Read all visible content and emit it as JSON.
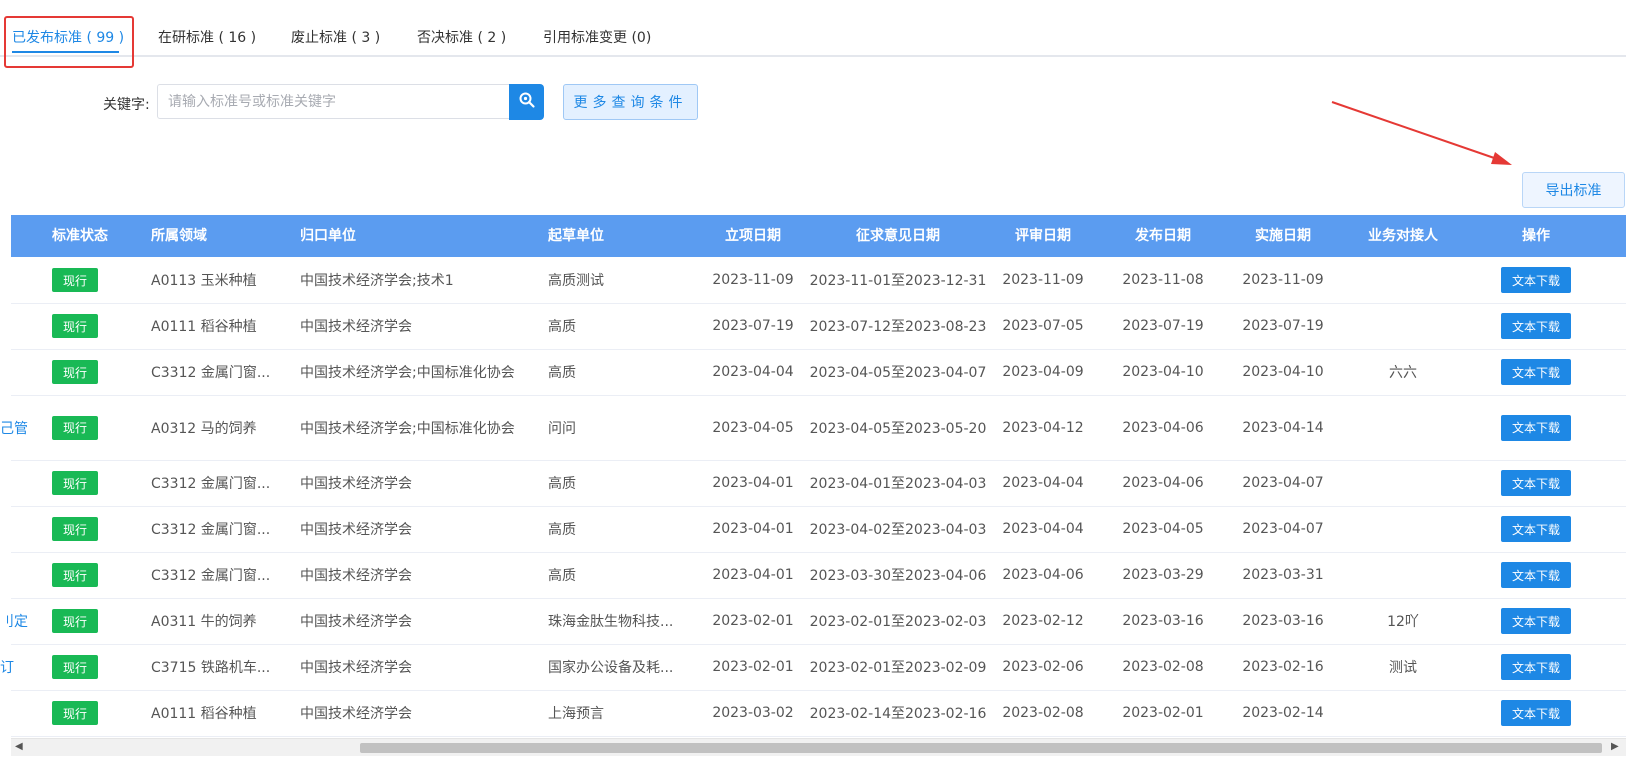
{
  "tabs": [
    {
      "label": "已发布标准 ( 99 )",
      "active": true
    },
    {
      "label": "在研标准 ( 16 )"
    },
    {
      "label": "废止标准 ( 3 )"
    },
    {
      "label": "否决标准 ( 2 )"
    },
    {
      "label": "引用标准变更 (0)"
    }
  ],
  "search": {
    "label": "关键字:",
    "placeholder": "请输入标准号或标准关键字",
    "search_icon": "search-icon",
    "more_label": "更多查询条件"
  },
  "export_label": "导出标准",
  "colors": {
    "accent": "#1e88e5",
    "header_bg": "#5b9cf0",
    "badge": "#19b955",
    "annotation": "#e53935"
  },
  "table": {
    "columns": [
      "标准状态",
      "所属领域",
      "归口单位",
      "起草单位",
      "立项日期",
      "征求意见日期",
      "评审日期",
      "发布日期",
      "实施日期",
      "业务对接人",
      "操作"
    ],
    "rows": [
      {
        "edge": "",
        "status": "现行",
        "domain": "A0113 玉米种植",
        "org": "中国技术经济学会;技术1",
        "drafter": "高质测试",
        "init": "2023-11-09",
        "comment": "2023-11-01至2023-12-31",
        "review": "2023-11-09",
        "publish": "2023-11-08",
        "impl": "2023-11-09",
        "contact": "",
        "action": "文本下载"
      },
      {
        "edge": "",
        "status": "现行",
        "domain": "A0111 稻谷种植",
        "org": "中国技术经济学会",
        "drafter": "高质",
        "init": "2023-07-19",
        "comment": "2023-07-12至2023-08-23",
        "review": "2023-07-05",
        "publish": "2023-07-19",
        "impl": "2023-07-19",
        "contact": "",
        "action": "文本下载"
      },
      {
        "edge": "",
        "status": "现行",
        "domain": "C3312 金属门窗...",
        "org": "中国技术经济学会;中国标准化协会",
        "drafter": "高质",
        "init": "2023-04-04",
        "comment": "2023-04-05至2023-04-07",
        "review": "2023-04-09",
        "publish": "2023-04-10",
        "impl": "2023-04-10",
        "contact": "六六",
        "action": "文本下载"
      },
      {
        "edge": "己管",
        "status": "现行",
        "domain": "A0312 马的饲养",
        "org": "中国技术经济学会;中国标准化协会",
        "drafter": "问问",
        "init": "2023-04-05",
        "comment": "2023-04-05至2023-05-20",
        "review": "2023-04-12",
        "publish": "2023-04-06",
        "impl": "2023-04-14",
        "contact": "",
        "action": "文本下载"
      },
      {
        "edge": "",
        "status": "现行",
        "domain": "C3312 金属门窗...",
        "org": "中国技术经济学会",
        "drafter": "高质",
        "init": "2023-04-01",
        "comment": "2023-04-01至2023-04-03",
        "review": "2023-04-04",
        "publish": "2023-04-06",
        "impl": "2023-04-07",
        "contact": "",
        "action": "文本下载"
      },
      {
        "edge": "",
        "status": "现行",
        "domain": "C3312 金属门窗...",
        "org": "中国技术经济学会",
        "drafter": "高质",
        "init": "2023-04-01",
        "comment": "2023-04-02至2023-04-03",
        "review": "2023-04-04",
        "publish": "2023-04-05",
        "impl": "2023-04-07",
        "contact": "",
        "action": "文本下载"
      },
      {
        "edge": "",
        "status": "现行",
        "domain": "C3312 金属门窗...",
        "org": "中国技术经济学会",
        "drafter": "高质",
        "init": "2023-04-01",
        "comment": "2023-03-30至2023-04-06",
        "review": "2023-04-06",
        "publish": "2023-03-29",
        "impl": "2023-03-31",
        "contact": "",
        "action": "文本下载"
      },
      {
        "edge": "刂定",
        "status": "现行",
        "domain": "A0311 牛的饲养",
        "org": "中国技术经济学会",
        "drafter": "珠海金肽生物科技...",
        "init": "2023-02-01",
        "comment": "2023-02-01至2023-02-03",
        "review": "2023-02-12",
        "publish": "2023-03-16",
        "impl": "2023-03-16",
        "contact": "12吖",
        "action": "文本下载"
      },
      {
        "edge": "订",
        "status": "现行",
        "domain": "C3715 铁路机车...",
        "org": "中国技术经济学会",
        "drafter": "国家办公设备及耗...",
        "init": "2023-02-01",
        "comment": "2023-02-01至2023-02-09",
        "review": "2023-02-06",
        "publish": "2023-02-08",
        "impl": "2023-02-16",
        "contact": "测试",
        "action": "文本下载"
      },
      {
        "edge": "",
        "status": "现行",
        "domain": "A0111 稻谷种植",
        "org": "中国技术经济学会",
        "drafter": "上海预言",
        "init": "2023-03-02",
        "comment": "2023-02-14至2023-02-16",
        "review": "2023-02-08",
        "publish": "2023-02-01",
        "impl": "2023-02-14",
        "contact": "",
        "action": "文本下载"
      }
    ]
  }
}
